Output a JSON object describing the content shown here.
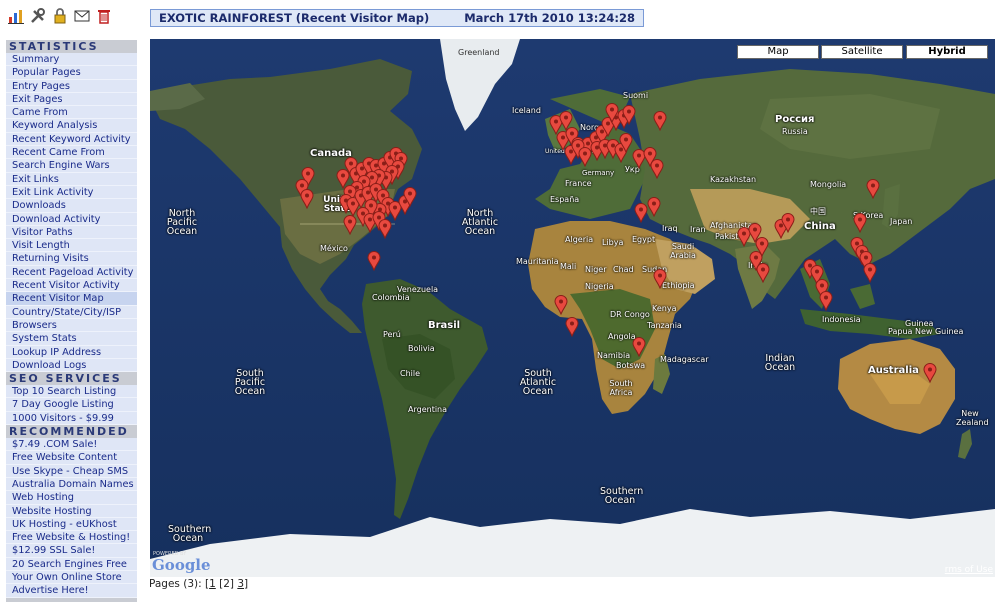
{
  "header": {
    "title": "EXOTIC RAINFOREST (Recent Visitor Map)",
    "datetime": "March 17th 2010 13:24:28"
  },
  "toolbar_icons": [
    "bar-chart-icon",
    "tools-icon",
    "lock-icon",
    "envelope-icon",
    "trash-icon"
  ],
  "sidebar": {
    "statistics": {
      "title": "STATISTICS",
      "items": [
        "Summary",
        "Popular Pages",
        "Entry Pages",
        "Exit Pages",
        "Came From",
        "Keyword Analysis",
        "Recent Keyword Activity",
        "Recent Came From",
        "Search Engine Wars",
        "Exit Links",
        "Exit Link Activity",
        "Downloads",
        "Download Activity",
        "Visitor Paths",
        "Visit Length",
        "Returning Visits",
        "Recent Pageload Activity",
        "Recent Visitor Activity",
        "Recent Visitor Map",
        "Country/State/City/ISP",
        "Browsers",
        "System Stats",
        "Lookup IP Address",
        "Download Logs"
      ],
      "active_index": 18
    },
    "seo": {
      "title": "SEO SERVICES",
      "items": [
        "Top 10 Search Listing",
        "7 Day Google Listing",
        "1000 Visitors - $9.99"
      ]
    },
    "recommended": {
      "title": "RECOMMENDED",
      "items": [
        "$7.49 .COM Sale!",
        "Free Website Content",
        "Use Skype - Cheap SMS",
        "Australia Domain Names",
        "Web Hosting",
        "Website Hosting",
        "UK Hosting - eUKhost",
        "Free Website & Hosting!",
        "$12.99 SSL Sale!",
        "20 Search Engines Free",
        "Your Own Online Store",
        "Advertise Here!"
      ]
    }
  },
  "map": {
    "types": [
      "Map",
      "Satellite",
      "Hybrid"
    ],
    "selected_type": "Hybrid",
    "labels": {
      "greenland": "Greenland",
      "iceland": "Iceland",
      "canada": "Canada",
      "usa": "United States",
      "mexico": "México",
      "venezuela": "Venezuela",
      "colombia": "Colombia",
      "peru": "Perú",
      "brasil": "Brasil",
      "bolivia": "Bolivia",
      "chile": "Chile",
      "argentina": "Argentina",
      "north_pacific": "North Pacific Ocean",
      "north_atlantic": "North Atlantic Ocean",
      "south_pacific": "South Pacific Ocean",
      "south_atlantic": "South Atlantic Ocean",
      "southern_left": "Southern Ocean",
      "southern": "Southern Ocean",
      "indian": "Indian Ocean",
      "suomi": "Suomi",
      "norge": "Norge",
      "united_kingdom": "United Kingdom",
      "france": "France",
      "germany": "Germany",
      "espana": "España",
      "ukraine": "Укр",
      "russia": "Россия",
      "russia_latin": "Russia",
      "kazakhstan": "Kazakhstan",
      "mongolia": "Mongolia",
      "china": "China",
      "china_cn": "中国",
      "afghanistan": "Afghanistan",
      "pakistan": "Pakistan",
      "iran": "Iran",
      "iraq": "Iraq",
      "saudi": "Saudi Arabia",
      "egypt": "Egypt",
      "libya": "Libya",
      "algeria": "Algeria",
      "mauritania": "Mauritania",
      "mali": "Mali",
      "niger": "Niger",
      "chad": "Chad",
      "sudan": "Sudan",
      "ethiopia": "Ethiopia",
      "nigeria": "Nigeria",
      "dr_congo": "DR Congo",
      "kenya": "Kenya",
      "tanzania": "Tanzania",
      "angola": "Angola",
      "namibia": "Namibia",
      "botswana": "Botswa",
      "south_africa": "South Africa",
      "madagascar": "Madagascar",
      "india": "India",
      "s_korea": "S.Korea",
      "japan": "Japan",
      "indonesia": "Indonesia",
      "guinea": "Guinea",
      "papua": "Papua New Guinea",
      "australia": "Australia",
      "new_zealand": "New Zealand"
    },
    "powered_by": "POWERED BY",
    "google": "Google",
    "terms": "rms of Use"
  },
  "pages": {
    "prefix": "Pages (3):",
    "open_bracket": "[",
    "page1": "1",
    "page2": "[2]",
    "page3": "3",
    "close_bracket": "]"
  }
}
